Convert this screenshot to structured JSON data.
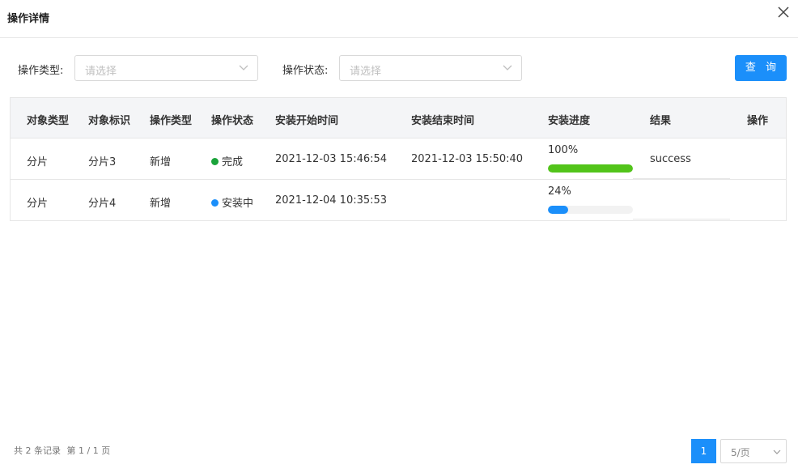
{
  "dialog": {
    "title": "操作详情"
  },
  "filters": {
    "op_type": {
      "label": "操作类型:",
      "placeholder": "请选择"
    },
    "op_status": {
      "label": "操作状态:",
      "placeholder": "请选择"
    },
    "query_label": "查 询"
  },
  "table": {
    "columns": [
      "对象类型",
      "对象标识",
      "操作类型",
      "操作状态",
      "安装开始时间",
      "安装结束时间",
      "安装进度",
      "结果",
      "操作"
    ],
    "rows": [
      {
        "object_type": "分片",
        "object_id": "分片3",
        "op_type": "新增",
        "status": "完成",
        "status_color": "#1aa33a",
        "start_time": "2021-12-03 15:46:54",
        "end_time": "2021-12-03 15:50:40",
        "progress_label": "100%",
        "progress": 100,
        "progress_color": "#52c41a",
        "result": "success"
      },
      {
        "object_type": "分片",
        "object_id": "分片4",
        "op_type": "新增",
        "status": "安装中",
        "status_color": "#1b8ffa",
        "start_time": "2021-12-04 10:35:53",
        "end_time": "",
        "progress_label": "24%",
        "progress": 24,
        "progress_color": "#1b8ffa",
        "result": ""
      }
    ]
  },
  "pagination": {
    "total_text": "共 2 条记录",
    "page_text": "第 1 / 1 页",
    "current_page": "1",
    "page_size": "5/页"
  },
  "colors": {
    "accent": "#1b8ffa",
    "success": "#52c41a"
  },
  "icons": {
    "close": "close-icon",
    "dropdown": "chevron-down-icon"
  }
}
